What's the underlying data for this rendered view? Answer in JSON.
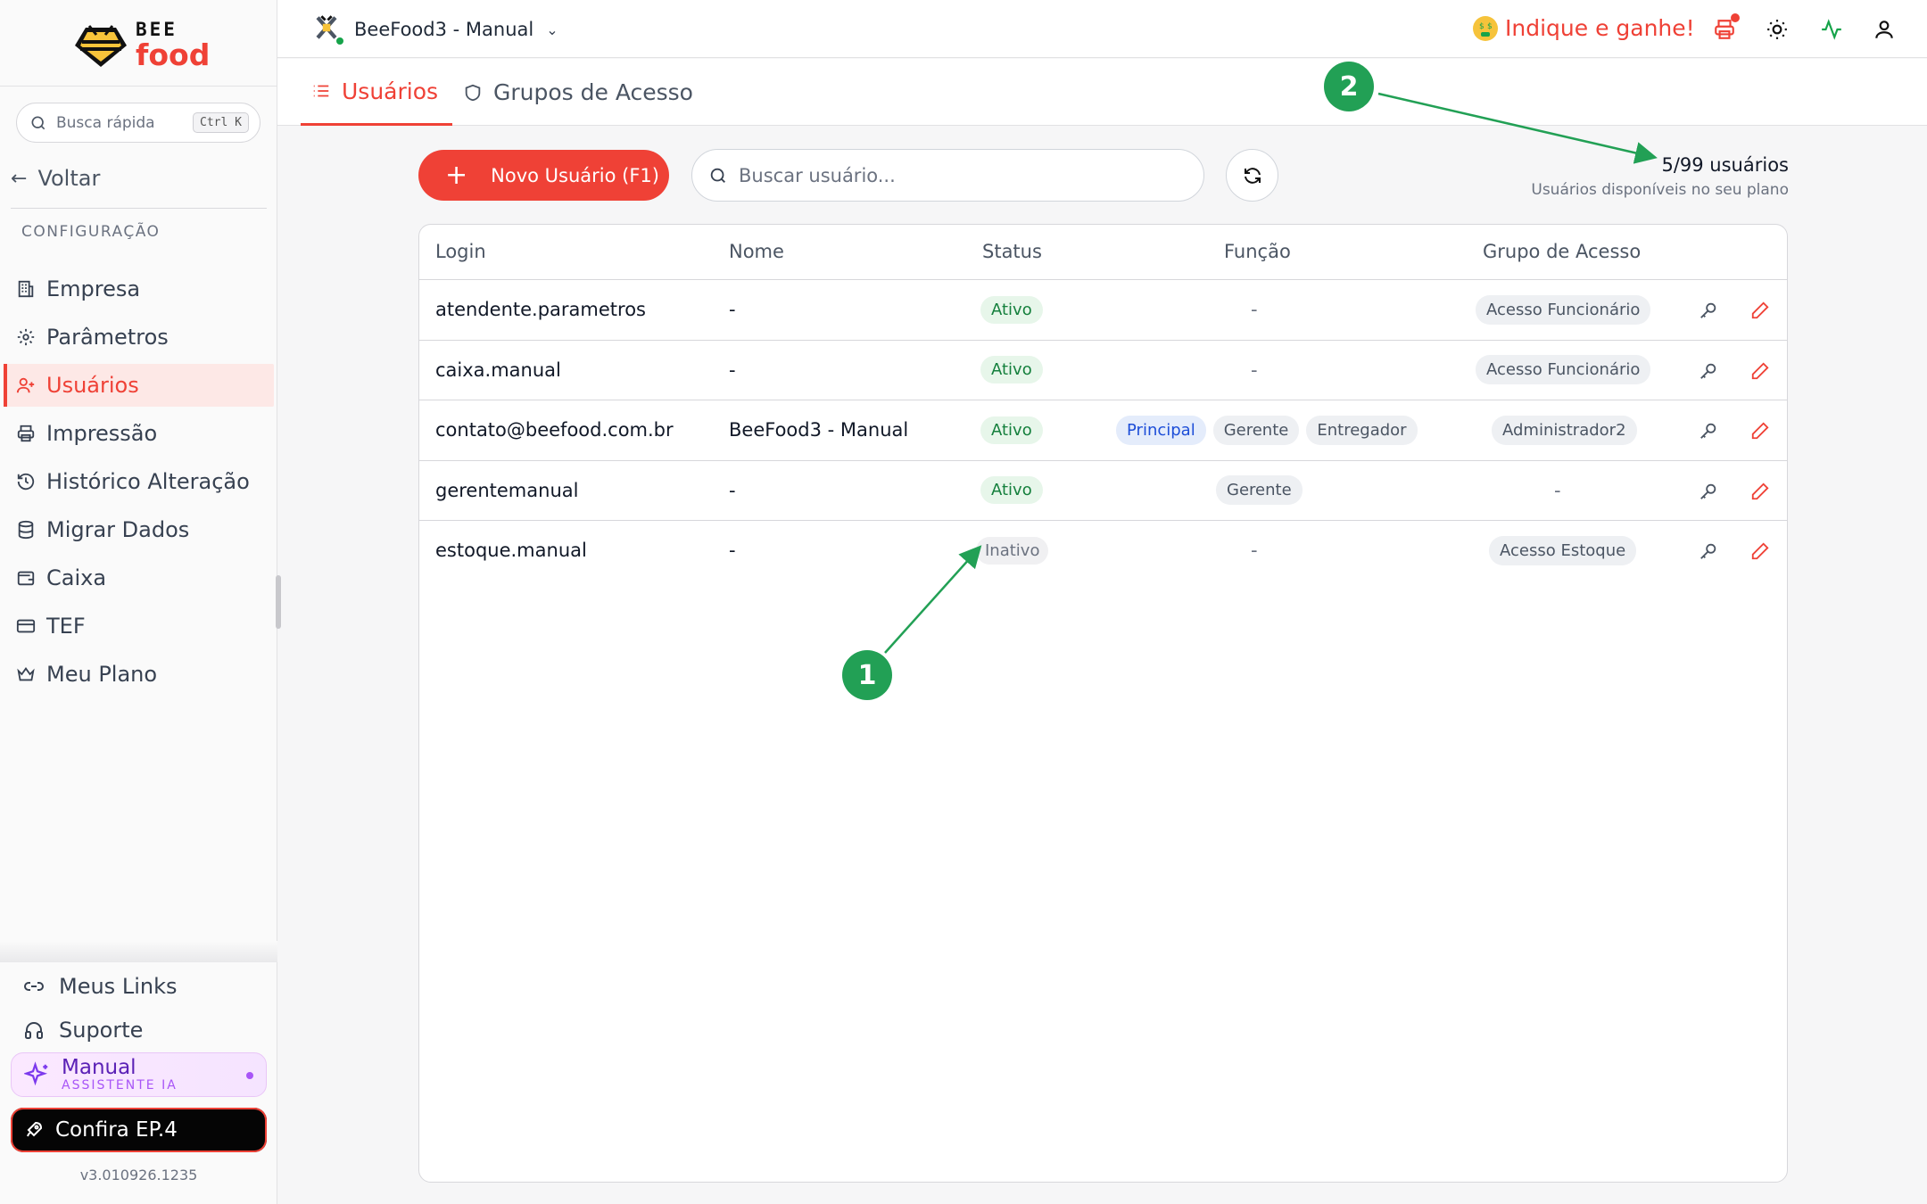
{
  "app": {
    "logo_top": "BEE",
    "logo_bottom": "food",
    "brand_color": "#ef4136"
  },
  "sidebar": {
    "quick_search_placeholder": "Busca rápida",
    "quick_search_shortcut": "Ctrl K",
    "back_label": "Voltar",
    "section_title": "CONFIGURAÇÃO",
    "items": [
      {
        "label": "Empresa",
        "icon": "building-icon",
        "active": false
      },
      {
        "label": "Parâmetros",
        "icon": "gear-icon",
        "active": false
      },
      {
        "label": "Usuários",
        "icon": "users-icon",
        "active": true
      },
      {
        "label": "Impressão",
        "icon": "printer-icon",
        "active": false
      },
      {
        "label": "Histórico Alteração",
        "icon": "history-icon",
        "active": false
      },
      {
        "label": "Migrar Dados",
        "icon": "database-icon",
        "active": false
      },
      {
        "label": "Caixa",
        "icon": "wallet-icon",
        "active": false
      },
      {
        "label": "TEF",
        "icon": "card-icon",
        "active": false
      },
      {
        "label": "Meu Plano",
        "icon": "crown-icon",
        "active": false
      }
    ],
    "links_label": "Meus Links",
    "support_label": "Suporte",
    "assistant_title": "Manual",
    "assistant_subtitle": "ASSISTENTE IA",
    "episode_label": "Confira EP.4",
    "version": "v3.010926.1235"
  },
  "header": {
    "company_name": "BeeFood3 - Manual",
    "referral_label": "Indique e ganhe!"
  },
  "tabs": [
    {
      "label": "Usuários",
      "active": true
    },
    {
      "label": "Grupos de Acesso",
      "active": false
    }
  ],
  "toolbar": {
    "new_user_label": "Novo Usuário (F1)",
    "search_placeholder": "Buscar usuário...",
    "users_count": "5/99 usuários",
    "users_hint": "Usuários disponíveis no seu plano"
  },
  "table": {
    "columns": [
      "Login",
      "Nome",
      "Status",
      "Função",
      "Grupo de Acesso"
    ],
    "rows": [
      {
        "login": "atendente.parametros",
        "nome": "-",
        "status": "Ativo",
        "funcao": "-",
        "grupo": "Acesso Funcionário"
      },
      {
        "login": "caixa.manual",
        "nome": "-",
        "status": "Ativo",
        "funcao": "-",
        "grupo": "Acesso Funcionário"
      },
      {
        "login": "contato@beefood.com.br",
        "nome": "BeeFood3 - Manual",
        "status": "Ativo",
        "funcoes": [
          "Principal",
          "Gerente",
          "Entregador"
        ],
        "grupo": "Administrador2"
      },
      {
        "login": "gerentemanual",
        "nome": "-",
        "status": "Ativo",
        "funcao": "Gerente",
        "grupo": "-"
      },
      {
        "login": "estoque.manual",
        "nome": "-",
        "status": "Inativo",
        "funcao": "-",
        "grupo": "Acesso Estoque"
      }
    ]
  },
  "annotations": [
    "1",
    "2"
  ]
}
